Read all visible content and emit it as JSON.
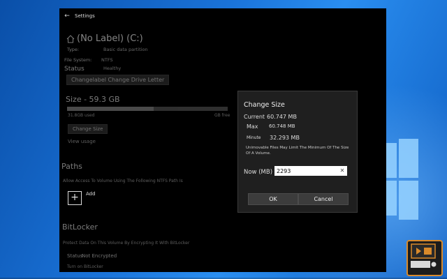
{
  "window": {
    "title": "Settings"
  },
  "drive": {
    "title": "(No Label) (C:)",
    "type_label": "Type:",
    "type_value": "Basic data partition",
    "fs_label": "File System:",
    "fs_value": "NTFS",
    "status_label": "Status",
    "status_value": "Healthy",
    "change_letter_button": "Changelabel Change Drive Letter",
    "size_title": "Size - 59.3 GB",
    "used_text": "31.8GB used",
    "free_text": "GB free",
    "used_fraction": 0.54,
    "change_size_button": "Change Size",
    "view_usage_link": "View usage"
  },
  "paths": {
    "title": "Paths",
    "description": "Allow Access To Volume Using The Following NTFS Path Is",
    "add_label": "Add"
  },
  "bitlocker": {
    "title": "BitLocker",
    "description": "Protect Data On This Volume By Encrypting It With BitLocker",
    "status_label": "Status",
    "status_value": "Not Encrypted",
    "turn_on_link": "Turn on BitLocker"
  },
  "dialog": {
    "title": "Change Size",
    "current_label": "Current",
    "current_value": "60.747 MB",
    "max_label": "Max",
    "max_value": "60.748 MB",
    "min_label": "Minute",
    "min_value": "32.293 MB",
    "note": "Unimovable Files May Limit The Minimum Of The Size Of A Volume.",
    "new_label": "Now (MB)",
    "new_value": "2293",
    "ok_label": "OK",
    "cancel_label": "Cancel"
  },
  "colors": {
    "accent": "#d98a2b",
    "desktop": "#1a73d9"
  }
}
